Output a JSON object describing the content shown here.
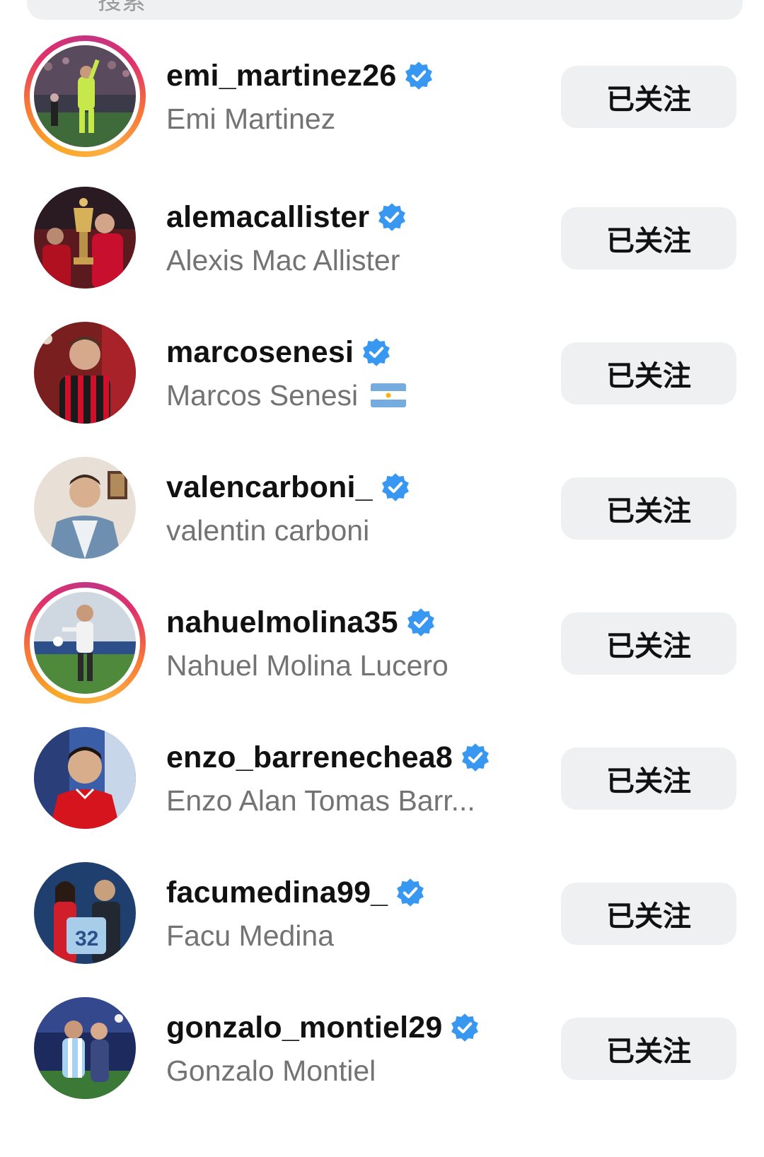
{
  "search": {
    "placeholder": "搜索"
  },
  "colors": {
    "verified_blue": "#3897f0",
    "button_bg": "#eef0f2",
    "username": "#111111",
    "fullname": "#737373",
    "story_ring": [
      "#fcaf45",
      "#f77737",
      "#e1306c",
      "#c13584"
    ]
  },
  "users": [
    {
      "username": "emi_martinez26",
      "full_name": "Emi Martinez",
      "verified": true,
      "has_story": true,
      "follow_label": "已关注",
      "avatar": "photo-goalkeeper-stadium"
    },
    {
      "username": "alemacallister",
      "full_name": "Alexis Mac Allister",
      "verified": true,
      "has_story": false,
      "follow_label": "已关注",
      "avatar": "photo-trophy-celebration"
    },
    {
      "username": "marcosenesi",
      "full_name": "Marcos Senesi",
      "verified": true,
      "has_story": false,
      "flag": "argentina-flag-icon",
      "follow_label": "已关注",
      "avatar": "photo-red-black-kit"
    },
    {
      "username": "valencarboni_",
      "full_name": "valentin carboni",
      "verified": true,
      "has_story": false,
      "follow_label": "已关注",
      "avatar": "photo-portrait-indoor"
    },
    {
      "username": "nahuelmolina35",
      "full_name": "Nahuel Molina Lucero",
      "verified": true,
      "has_story": true,
      "follow_label": "已关注",
      "avatar": "photo-training-pitch"
    },
    {
      "username": "enzo_barrenechea8",
      "full_name": "Enzo Alan Tomas Barr...",
      "verified": true,
      "has_story": false,
      "follow_label": "已关注",
      "avatar": "photo-red-jacket-portrait"
    },
    {
      "username": "facumedina99_",
      "full_name": "Facu Medina",
      "verified": true,
      "has_story": false,
      "follow_label": "已关注",
      "avatar": "photo-jersey-presentation"
    },
    {
      "username": "gonzalo_montiel29",
      "full_name": "Gonzalo Montiel",
      "verified": true,
      "has_story": false,
      "follow_label": "已关注",
      "avatar": "photo-stadium-couple"
    }
  ]
}
